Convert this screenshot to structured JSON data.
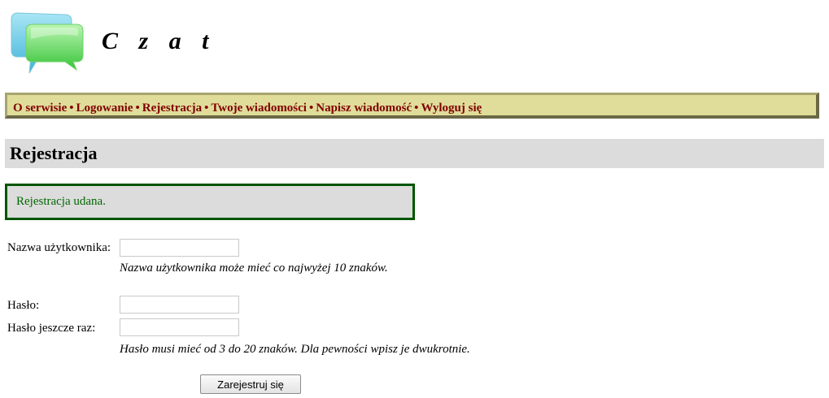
{
  "site": {
    "title": "C z a t"
  },
  "nav": {
    "items": [
      {
        "label": "O serwisie"
      },
      {
        "label": "Logowanie"
      },
      {
        "label": "Rejestracja"
      },
      {
        "label": "Twoje wiadomości"
      },
      {
        "label": "Napisz wiadomość"
      },
      {
        "label": "Wyloguj się"
      }
    ],
    "separator": "•"
  },
  "page": {
    "heading": "Rejestracja",
    "message": "Rejestracja udana."
  },
  "form": {
    "username_label": "Nazwa użytkownika:",
    "username_value": "",
    "username_hint": "Nazwa użytkownika może mieć co najwyżej 10 znaków.",
    "password_label": "Hasło:",
    "password_value": "",
    "password_repeat_label": "Hasło jeszcze raz:",
    "password_repeat_value": "",
    "password_hint": "Hasło musi mieć od 3 do 20 znaków. Dla pewności wpisz je dwukrotnie.",
    "submit_label": "Zarejestruj się"
  },
  "colors": {
    "menu_background": "#e0dd9b",
    "menu_text": "#800000",
    "heading_background": "#dcdcdc",
    "success_border": "#005500",
    "success_text": "#006600"
  }
}
